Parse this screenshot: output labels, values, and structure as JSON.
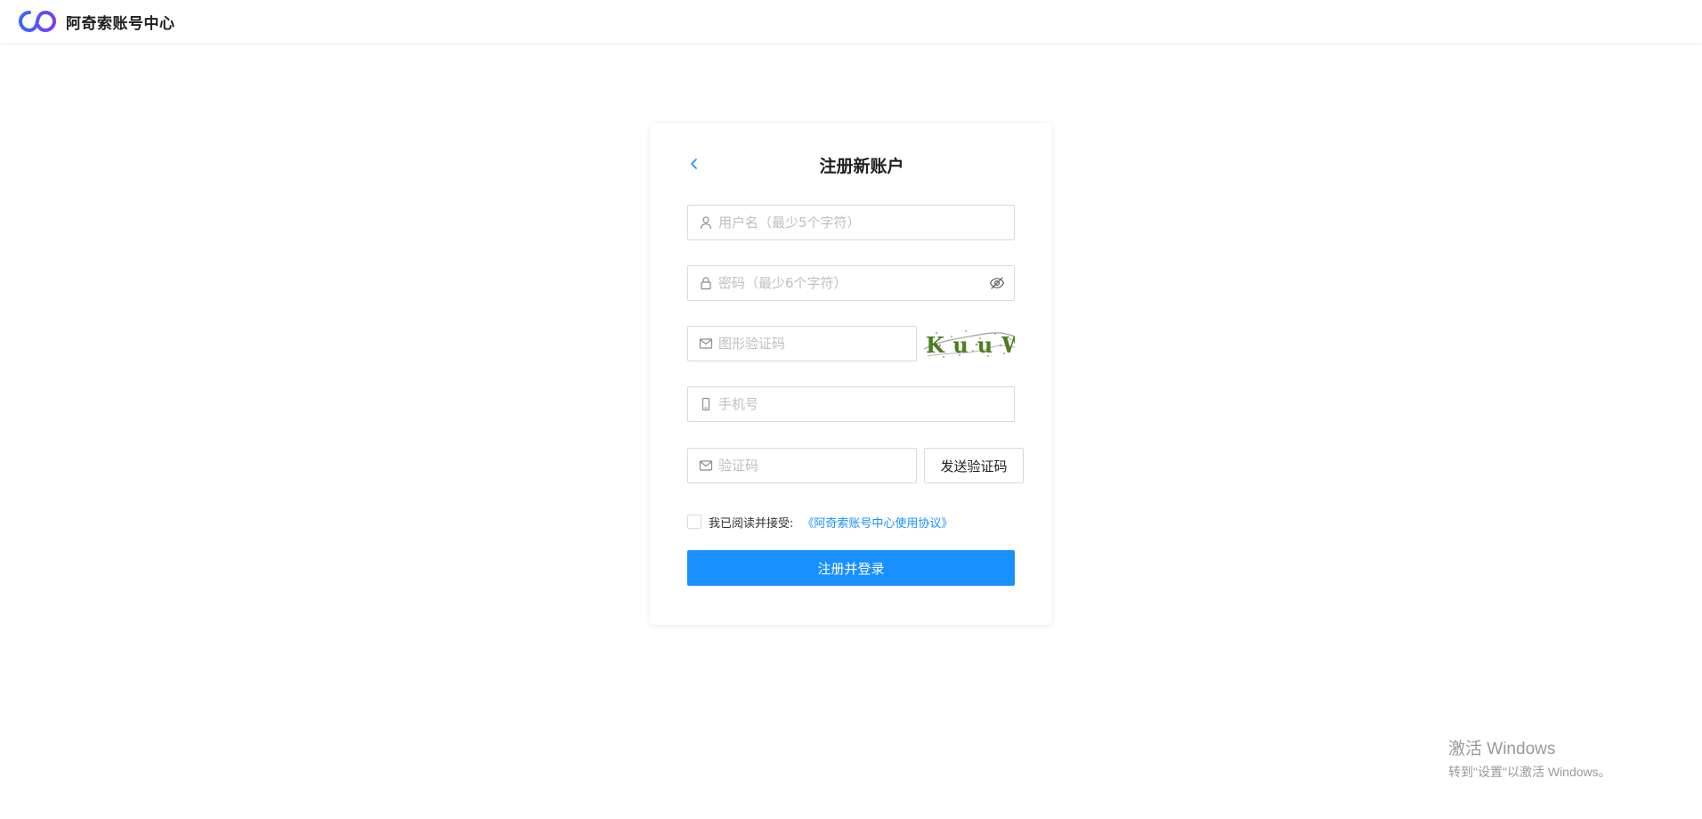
{
  "header": {
    "app_name": "阿奇索账号中心",
    "logo": "infinity-logo-icon"
  },
  "register_form": {
    "title": "注册新账户",
    "back_icon": "chevron-left-icon",
    "username": {
      "placeholder": "用户名（最少5个字符）",
      "value": "",
      "icon": "user-icon"
    },
    "password": {
      "placeholder": "密码（最少6个字符）",
      "value": "",
      "icon": "lock-icon",
      "toggle_icon": "eye-hidden-icon"
    },
    "captcha": {
      "placeholder": "图形验证码",
      "value": "",
      "icon": "mail-icon",
      "image_text": "KuuW"
    },
    "phone": {
      "placeholder": "手机号",
      "value": "",
      "icon": "mobile-icon"
    },
    "sms_code": {
      "placeholder": "验证码",
      "value": "",
      "icon": "mail-icon",
      "send_button_label": "发送验证码"
    },
    "agreement": {
      "checked": false,
      "text": "我已阅读并接受:",
      "link_label": "《阿奇索账号中心使用协议》"
    },
    "submit_label": "注册并登录"
  },
  "os_watermark": {
    "line1": "激活 Windows",
    "line2": "转到\"设置\"以激活 Windows。"
  },
  "colors": {
    "primary": "#1890ff",
    "logo_blue": "#2f6bff",
    "logo_purple": "#7b3cf5",
    "border": "#d9d9d9",
    "placeholder": "#bfbfbf"
  }
}
